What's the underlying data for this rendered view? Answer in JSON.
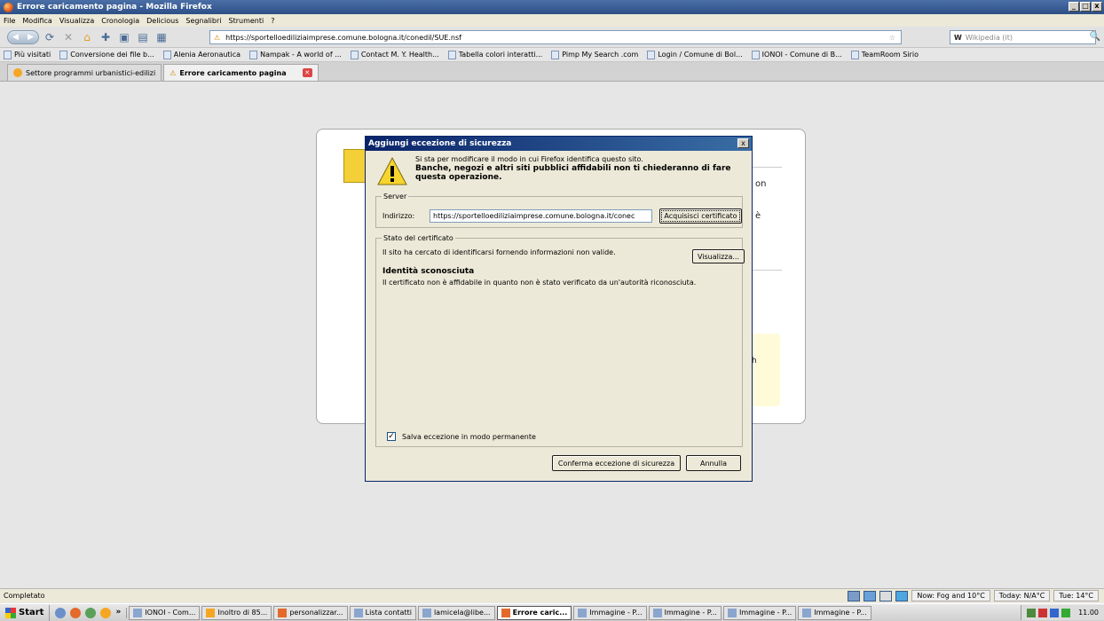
{
  "window": {
    "title": "Errore caricamento pagina - Mozilla Firefox",
    "controls": [
      "_",
      "□",
      "x"
    ]
  },
  "menu": [
    "File",
    "Modifica",
    "Visualizza",
    "Cronologia",
    "Delicious",
    "Segnalibri",
    "Strumenti",
    "?"
  ],
  "nav": {
    "url": "https://sportelloediliziaimprese.comune.bologna.it/conedil/SUE.nsf",
    "search_placeholder": "Wikipedia (it)"
  },
  "bookmarks": [
    "Più visitati",
    "Conversione dei file b...",
    "Alenia Aeronautica",
    "Nampak - A world of ...",
    "Contact M. Y. Health...",
    "Tabella colori interatti...",
    "Pimp My Search .com",
    "Login / Comune di Bol...",
    "IONOI - Comune di B...",
    "TeamRoom Sirio"
  ],
  "tabs": [
    {
      "label": "Settore programmi urbanistici-edilizi",
      "active": false
    },
    {
      "label": "Errore caricamento pagina",
      "active": true
    }
  ],
  "error_page": {
    "frag_on": "on",
    "frag_e": "è",
    "frag_h": "h"
  },
  "dialog": {
    "title": "Aggiungi eccezione di sicurezza",
    "close": "x",
    "intro": "Si sta per modificare il modo in cui Firefox identifica questo sito.",
    "warning": "Banche, negozi e altri siti pubblici affidabili non ti chiederanno di fare questa operazione.",
    "server_legend": "Server",
    "address_label": "Indirizzo:",
    "address_value": "https://sportelloediliziaimprese.comune.bologna.it/conec",
    "get_cert_button": "Acquisisci certificato",
    "cert_legend": "Stato del certificato",
    "cert_status": "Il sito ha cercato di identificarsi fornendo informazioni non valide.",
    "view_button": "Visualizza...",
    "identity_title": "Identità sconosciuta",
    "identity_desc": "Il certificato non è affidabile in quanto non è stato verificato da un'autorità riconosciuta.",
    "permanent_label": "Salva eccezione in modo permanente",
    "permanent_checked": true,
    "confirm_button": "Conferma eccezione di sicurezza",
    "cancel_button": "Annulla"
  },
  "status": {
    "text": "Completato",
    "weather_now": "Now: Fog and 10°C",
    "weather_today": "Today: N/A°C",
    "weather_tue": "Tue: 14°C"
  },
  "taskbar": {
    "start": "Start",
    "chevron": "»",
    "tasks": [
      {
        "label": "IONOI - Com...",
        "active": false
      },
      {
        "label": "Inoltro di 85...",
        "active": false
      },
      {
        "label": "personalizzar...",
        "active": false
      },
      {
        "label": "Lista contatti",
        "active": false
      },
      {
        "label": "lamicela@libe...",
        "active": false
      },
      {
        "label": "Errore caric...",
        "active": true
      },
      {
        "label": "Immagine - P...",
        "active": false
      },
      {
        "label": "Immagine - P...",
        "active": false
      },
      {
        "label": "Immagine - P...",
        "active": false
      },
      {
        "label": "Immagine - P...",
        "active": false
      }
    ],
    "clock": "11.00"
  }
}
